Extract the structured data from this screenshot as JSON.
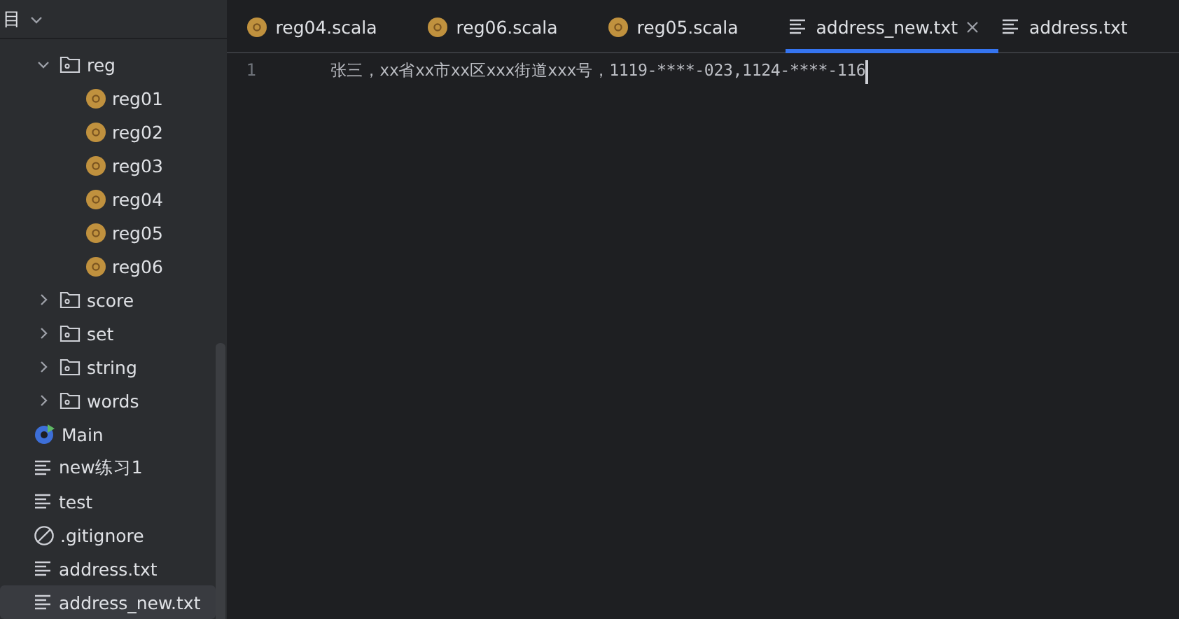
{
  "sidebar": {
    "header": "目",
    "tree": [
      {
        "kind": "folder",
        "name": "reg",
        "expanded": true,
        "selected": false,
        "children": [
          {
            "kind": "scala",
            "name": "reg01",
            "selected": false
          },
          {
            "kind": "scala",
            "name": "reg02",
            "selected": false
          },
          {
            "kind": "scala",
            "name": "reg03",
            "selected": false
          },
          {
            "kind": "scala",
            "name": "reg04",
            "selected": false
          },
          {
            "kind": "scala",
            "name": "reg05",
            "selected": false
          },
          {
            "kind": "scala",
            "name": "reg06",
            "selected": false
          }
        ]
      },
      {
        "kind": "folder",
        "name": "score",
        "expanded": false,
        "selected": false
      },
      {
        "kind": "folder",
        "name": "set",
        "expanded": false,
        "selected": false
      },
      {
        "kind": "folder",
        "name": "string",
        "expanded": false,
        "selected": false
      },
      {
        "kind": "folder",
        "name": "words",
        "expanded": false,
        "selected": false
      },
      {
        "kind": "object",
        "name": "Main",
        "selected": false
      },
      {
        "kind": "text",
        "name": "new练习1",
        "selected": false
      },
      {
        "kind": "text",
        "name": "test",
        "selected": false
      }
    ],
    "root_items": [
      {
        "kind": "ignore",
        "name": ".gitignore",
        "selected": false
      },
      {
        "kind": "text",
        "name": "address.txt",
        "selected": false
      },
      {
        "kind": "text",
        "name": "address_new.txt",
        "selected": true
      }
    ]
  },
  "tabs": [
    {
      "kind": "scala",
      "label": "reg04.scala",
      "selected": false
    },
    {
      "kind": "scala",
      "label": "reg06.scala",
      "selected": false
    },
    {
      "kind": "scala",
      "label": "reg05.scala",
      "selected": false
    },
    {
      "kind": "text",
      "label": "address_new.txt",
      "selected": true
    },
    {
      "kind": "text",
      "label": "address.txt",
      "selected": false
    }
  ],
  "editor": {
    "lines": [
      {
        "number": "1",
        "text": "张三，xx省xx市xx区xxx街道xxx号，1119-****-023,1124-****-116"
      }
    ]
  }
}
